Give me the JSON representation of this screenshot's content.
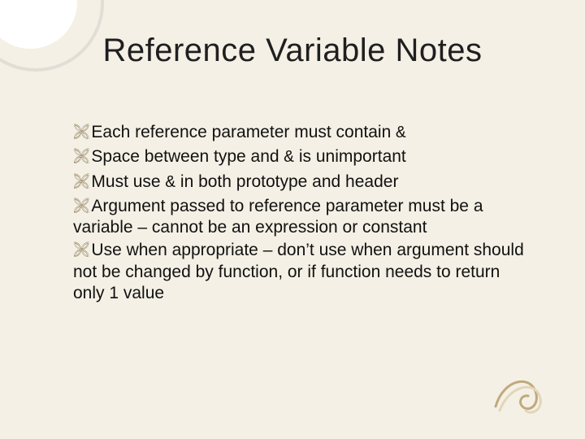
{
  "slide": {
    "title": "Reference Variable Notes",
    "bullets": [
      {
        "pre": "Each reference parameter must contain ",
        "code": "&",
        "post": ""
      },
      {
        "pre": "Space between type and ",
        "code": "&",
        "post": " is unimportant"
      },
      {
        "pre": "Must use ",
        "code": "&",
        "post": " in both prototype and header"
      },
      {
        "pre": "Argument passed to reference parameter must be a variable – cannot be an expression or constant",
        "code": "",
        "post": ""
      },
      {
        "pre": "Use when appropriate – don’t use when argument should not be changed by function, or if function needs to return only 1 value",
        "code": "",
        "post": ""
      }
    ],
    "bullet_marker": "༄"
  }
}
